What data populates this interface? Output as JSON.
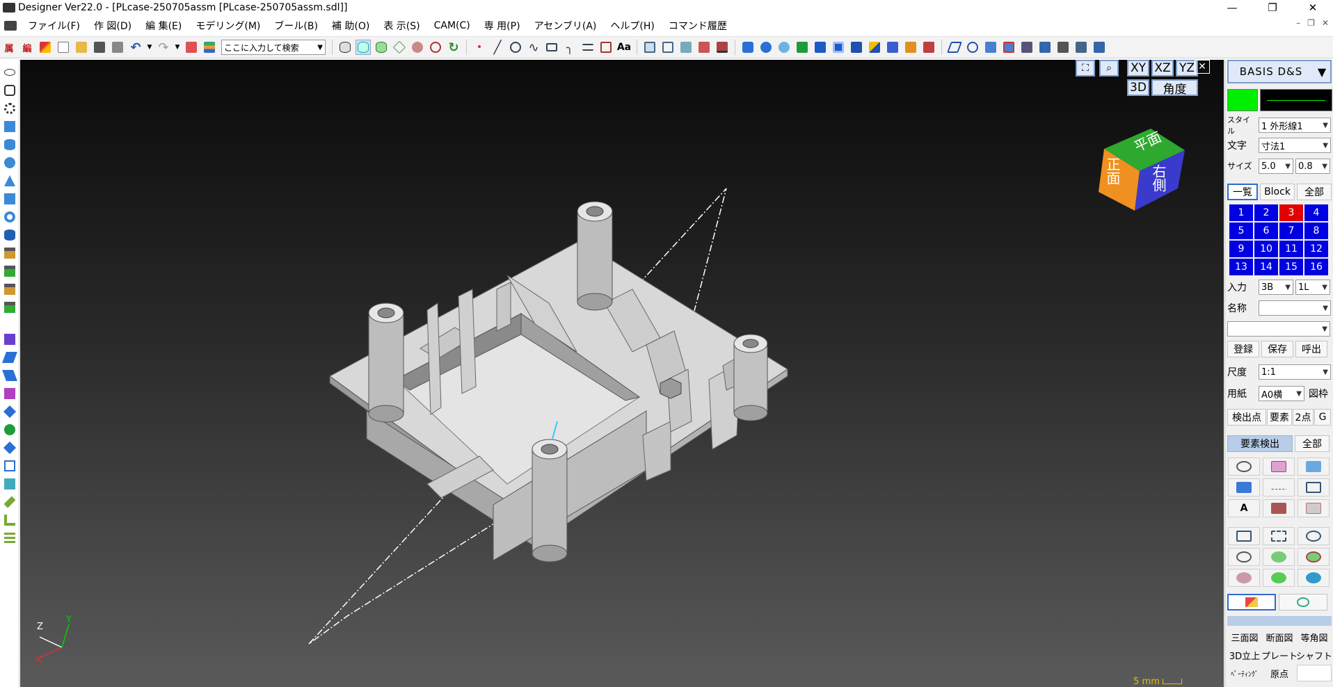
{
  "window": {
    "title": "Designer Ver22.0 - [PLcase-250705assm [PLcase-250705assm.sdl]]",
    "minimize": "—",
    "maximize": "❐",
    "close": "✕"
  },
  "menu": {
    "items": [
      "ファイル(F)",
      "作 図(D)",
      "編 集(E)",
      "モデリング(M)",
      "ブール(B)",
      "補 助(O)",
      "表 示(S)",
      "CAM(C)",
      "専 用(P)",
      "アセンブリ(A)",
      "ヘルプ(H)",
      "コマンド履歴"
    ],
    "mdi_min": "–",
    "mdi_restore": "❐",
    "mdi_close": "✕"
  },
  "toolbar": {
    "attr_label": "属",
    "edit_label": "編",
    "search_placeholder": "ここに入力して検索",
    "text_tool": "Aa"
  },
  "viewport": {
    "view_buttons": [
      "XY",
      "XZ",
      "YZ"
    ],
    "btn_3d": "3D",
    "btn_angle": "角度",
    "close": "✕",
    "scale": "5 mm",
    "cube_faces": [
      "平面",
      "正面",
      "右側"
    ],
    "axis_labels": [
      "Z",
      "Y",
      "X"
    ]
  },
  "panel": {
    "header": "BASIS D&S",
    "style_label": "スタイル",
    "style_value": "1 外形線1",
    "text_label": "文字",
    "text_value": "寸法1",
    "size_label": "サイズ",
    "size_value": "5.0",
    "size_value2": "0.8",
    "tabs": [
      "一覧",
      "Block",
      "全部"
    ],
    "layers": [
      "1",
      "2",
      "3",
      "4",
      "5",
      "6",
      "7",
      "8",
      "9",
      "10",
      "11",
      "12",
      "13",
      "14",
      "15",
      "16"
    ],
    "active_layer": "3",
    "input_label": "入力",
    "input_value": "3B",
    "input_value2": "1L",
    "name_label": "名称",
    "register": "登録",
    "save": "保存",
    "recall": "呼出",
    "scale_label": "尺度",
    "scale_value": "1:1",
    "paper_label": "用紙",
    "paper_value": "A0横",
    "frame": "図枠",
    "snap_tabs": [
      "検出点",
      "要素",
      "2点",
      "G"
    ],
    "elem_detect": "要素検出",
    "all": "全部",
    "bottom_buttons": [
      "三面図",
      "断面図",
      "等角図",
      "3D立上",
      "プレート",
      "シャフト",
      "ﾍﾟｰﾃｨﾝｸﾞ",
      "原点",
      ""
    ]
  },
  "colors": {
    "layer_blue": "#0000e0",
    "layer_active": "#e00000",
    "current_color": "#00ee00",
    "scale_text": "#e0c000"
  }
}
